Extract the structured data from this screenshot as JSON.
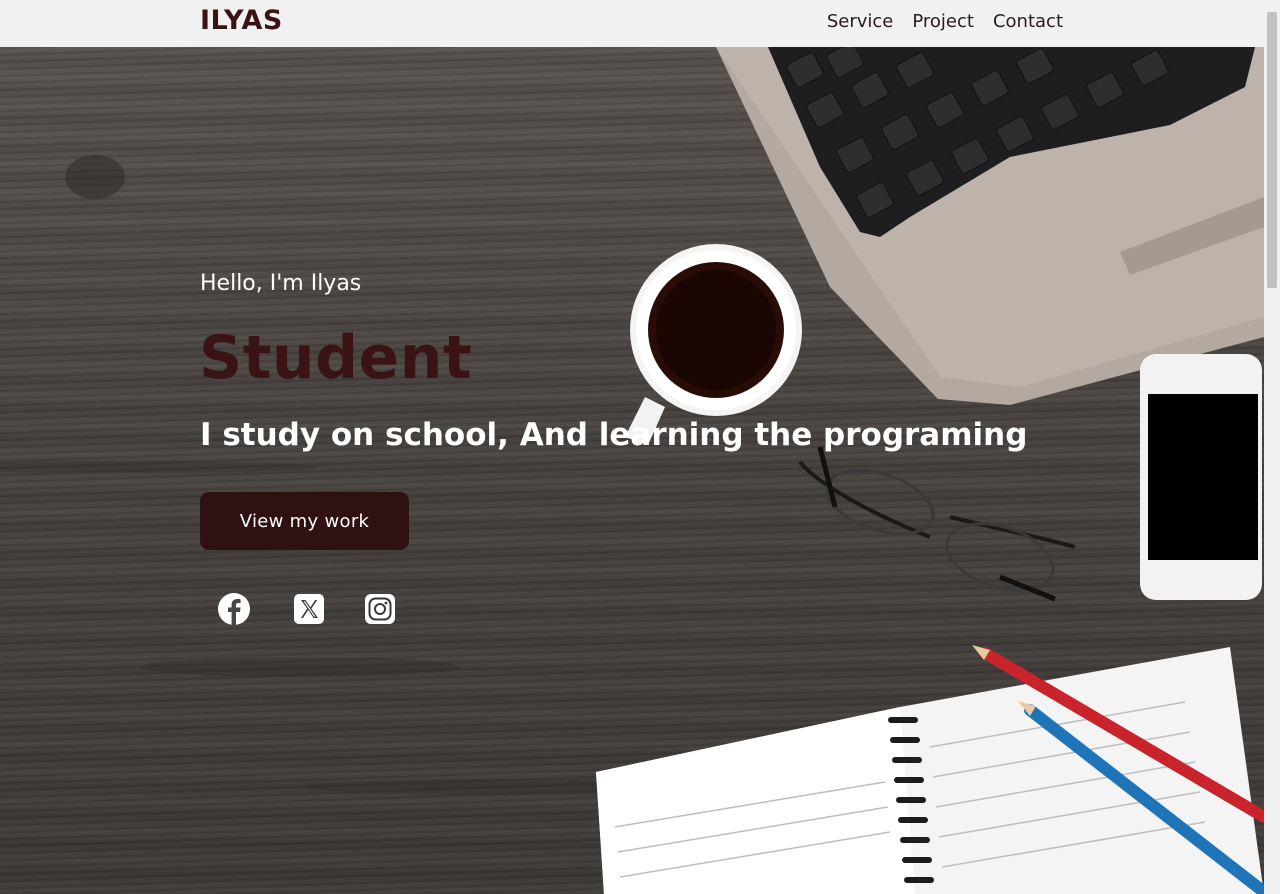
{
  "nav": {
    "brand": "ILYAS",
    "links": [
      "Service",
      "Project",
      "Contact"
    ]
  },
  "hero": {
    "greeting": "Hello, I'm Ilyas",
    "role": "Student",
    "tagline": "I study on school, And learning the programing",
    "cta_label": "View my work"
  },
  "socials": [
    "facebook-icon",
    "x-twitter-icon",
    "instagram-icon"
  ],
  "colors": {
    "accent": "#3a1414",
    "button": "#2f1112",
    "navbar_bg": "#f1f1f1",
    "text_light": "#ffffff"
  }
}
